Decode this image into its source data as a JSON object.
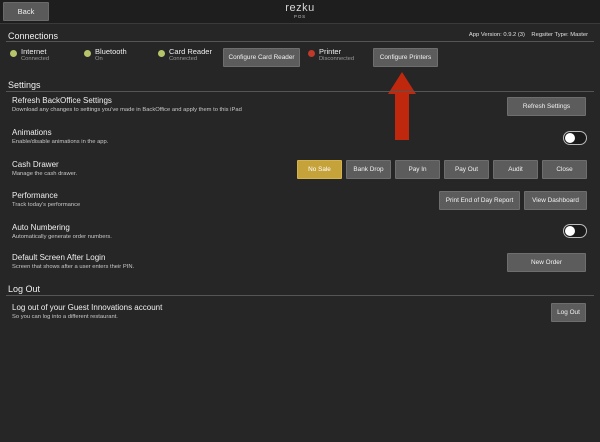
{
  "header": {
    "back_label": "Back",
    "brand_name": "rezku",
    "brand_sub": "POS"
  },
  "connections": {
    "title": "Connections",
    "app_info": "App Version: 0.9.2 (3)    Regsiter Type: Master",
    "items": [
      {
        "name": "Internet",
        "status": "Connected",
        "color": "#b8c46a"
      },
      {
        "name": "Bluetooth",
        "status": "On",
        "color": "#b8c46a"
      },
      {
        "name": "Card Reader",
        "status": "Connected",
        "color": "#b8c46a"
      },
      {
        "name": "Printer",
        "status": "Disconnected",
        "color": "#c0392b"
      }
    ],
    "configure_card_reader_label": "Configure Card Reader",
    "configure_printers_label": "Configure Printers"
  },
  "settings": {
    "title": "Settings",
    "refresh": {
      "title": "Refresh BackOffice Settings",
      "desc": "Download any changes to settings you've made in BackOffice and apply them to this iPad",
      "button": "Refresh Settings"
    },
    "animations": {
      "title": "Animations",
      "desc": "Enable/disable animations in the app.",
      "enabled": false
    },
    "cash_drawer": {
      "title": "Cash Drawer",
      "desc": "Manage the cash drawer.",
      "buttons": [
        "No Sale",
        "Bank Drop",
        "Pay In",
        "Pay Out",
        "Audit",
        "Close"
      ]
    },
    "performance": {
      "title": "Performance",
      "desc": "Track today's performance",
      "print_label": "Print End of Day Report",
      "dashboard_label": "View Dashboard"
    },
    "auto_numbering": {
      "title": "Auto Numbering",
      "desc": "Automatically generate order numbers.",
      "enabled": false
    },
    "default_screen": {
      "title": "Default Screen After Login",
      "desc": "Screen that shows after a user enters their PIN.",
      "button": "New Order"
    }
  },
  "logout": {
    "title": "Log Out",
    "item_title": "Log out of your Guest Innovations account",
    "item_desc": "So you can log into a different restaurant.",
    "button": "Log Out"
  },
  "colors": {
    "background": "#262626",
    "button": "#5c5c5c",
    "accent_gold": "#c6a23a",
    "arrow_red": "#c0280e"
  }
}
